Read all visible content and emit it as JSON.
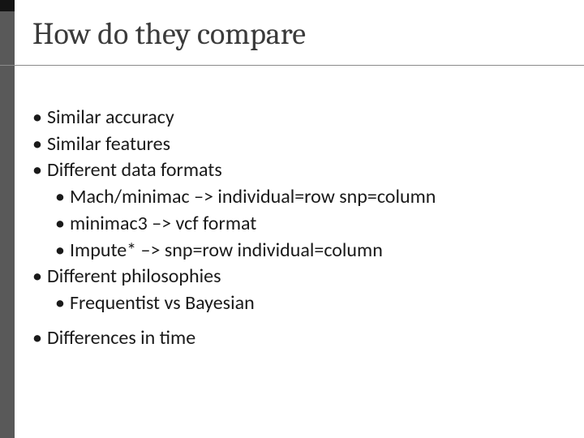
{
  "title": "How do they compare",
  "bullets": {
    "b1": "Similar accuracy",
    "b2": "Similar features",
    "b3": "Different data formats",
    "b3a": "Mach/minimac –> individual=row snp=column",
    "b3b": "minimac3 –> vcf format",
    "b3c": "Impute* –> snp=row individual=column",
    "b4": "Different philosophies",
    "b4a": "Frequentist vs Bayesian",
    "b5": "Differences in time"
  }
}
